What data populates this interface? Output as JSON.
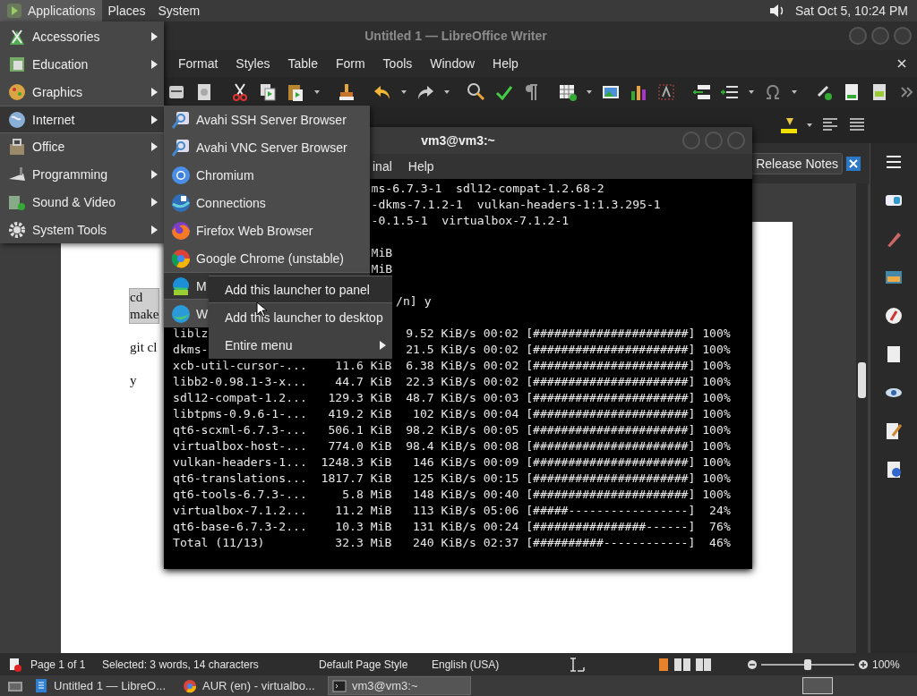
{
  "top_panel": {
    "menus": [
      {
        "label": "Applications",
        "selected": true
      },
      {
        "label": "Places",
        "selected": false
      },
      {
        "label": "System",
        "selected": false
      }
    ],
    "clock": "Sat Oct 5, 10:24 PM"
  },
  "writer": {
    "title": "Untitled 1 — LibreOffice Writer",
    "menus": [
      "Format",
      "Styles",
      "Table",
      "Form",
      "Tools",
      "Window",
      "Help"
    ],
    "infobar": {
      "button": "Release Notes"
    },
    "paragraphs": [
      {
        "lines": [
          "cd",
          "make"
        ],
        "selected": true
      },
      {
        "lines": [
          "git cl"
        ],
        "selected": false
      },
      {
        "lines": [
          "y"
        ],
        "selected": false
      }
    ],
    "status_bar": {
      "page": "Page 1 of 1",
      "selection": "Selected: 3 words, 14 characters",
      "page_style": "Default Page Style",
      "language": "English (USA)",
      "zoom_slider": {
        "level": 0.5
      },
      "zoom": "100%"
    }
  },
  "terminal": {
    "title": "vm3@vm3:~",
    "menus": [
      "inal",
      "Help"
    ],
    "lines": [
      {
        "kind": "edge",
        "text": "ms-6.7.3-1  sdl12-compat-1.2.68-2"
      },
      {
        "kind": "edge",
        "text": "-dkms-7.1.2-1  vulkan-headers-1:1.3.295-1"
      },
      {
        "kind": "edge",
        "text": "-0.1.5-1  virtualbox-7.1.2-1"
      },
      {
        "kind": "blank"
      },
      {
        "kind": "edge",
        "text": "MiB"
      },
      {
        "kind": "edge",
        "text": "MiB"
      },
      {
        "kind": "blank"
      },
      {
        "kind": "after",
        "text": "/n] y"
      },
      {
        "kind": "blank"
      },
      {
        "kind": "split",
        "head": "liblz",
        "text": "9.52 KiB/s 00:02 [######################] 100%"
      },
      {
        "kind": "split",
        "head": "dkms-",
        "text": "21.5 KiB/s 00:02 [######################] 100%"
      },
      {
        "kind": "full",
        "text": "xcb-util-cursor-...    11.6 KiB  6.38 KiB/s 00:02 [######################] 100%"
      },
      {
        "kind": "full",
        "text": "libb2-0.98.1-3-x...    44.7 KiB  22.3 KiB/s 00:02 [######################] 100%"
      },
      {
        "kind": "full",
        "text": "sdl12-compat-1.2...   129.3 KiB  48.7 KiB/s 00:03 [######################] 100%"
      },
      {
        "kind": "full",
        "text": "libtpms-0.9.6-1-...   419.2 KiB   102 KiB/s 00:04 [######################] 100%"
      },
      {
        "kind": "full",
        "text": "qt6-scxml-6.7.3-...   506.1 KiB  98.2 KiB/s 00:05 [######################] 100%"
      },
      {
        "kind": "full",
        "text": "virtualbox-host-...   774.0 KiB  98.4 KiB/s 00:08 [######################] 100%"
      },
      {
        "kind": "full",
        "text": "vulkan-headers-1...  1248.3 KiB   146 KiB/s 00:09 [######################] 100%"
      },
      {
        "kind": "full",
        "text": "qt6-translations...  1817.7 KiB   125 KiB/s 00:15 [######################] 100%"
      },
      {
        "kind": "full",
        "text": "qt6-tools-6.7.3-...     5.8 MiB   148 KiB/s 00:40 [######################] 100%"
      },
      {
        "kind": "full",
        "text": "virtualbox-7.1.2...    11.2 MiB   113 KiB/s 05:06 [#####-----------------]  24%"
      },
      {
        "kind": "full",
        "text": "qt6-base-6.7.3-2...    10.3 MiB   131 KiB/s 00:24 [################------]  76%"
      },
      {
        "kind": "full",
        "text": "Total (11/13)          32.3 MiB   240 KiB/s 02:37 [##########------------]  46%"
      }
    ]
  },
  "applications_menu": {
    "items": [
      {
        "label": "Accessories",
        "selected": false
      },
      {
        "label": "Education",
        "selected": false
      },
      {
        "label": "Graphics",
        "selected": false
      },
      {
        "label": "Internet",
        "selected": true
      },
      {
        "label": "Office",
        "selected": false
      },
      {
        "label": "Programming",
        "selected": false
      },
      {
        "label": "Sound & Video",
        "selected": false
      },
      {
        "label": "System Tools",
        "selected": false
      }
    ]
  },
  "internet_menu": {
    "items": [
      {
        "label": "Avahi SSH Server Browser",
        "selected": false
      },
      {
        "label": "Avahi VNC Server Browser",
        "selected": false
      },
      {
        "label": "Chromium",
        "selected": false
      },
      {
        "label": "Connections",
        "selected": false
      },
      {
        "label": "Firefox Web Browser",
        "selected": false
      },
      {
        "label": "Google Chrome (unstable)",
        "selected": false
      },
      {
        "label": "M",
        "selected": true
      },
      {
        "label": "W",
        "selected": false
      }
    ]
  },
  "context_menu": {
    "items": [
      {
        "label": "Add this launcher to panel",
        "selected": true,
        "submenu": false
      },
      {
        "label": "Add this launcher to desktop",
        "selected": false,
        "submenu": false
      },
      {
        "label": "Entire menu",
        "selected": false,
        "submenu": true
      }
    ]
  },
  "taskbar": {
    "tasks": [
      {
        "label": "Untitled 1 — LibreO...",
        "selected": false
      },
      {
        "label": "AUR (en) - virtualbo...",
        "selected": false
      },
      {
        "label": "vm3@vm3:~",
        "selected": true
      }
    ]
  }
}
